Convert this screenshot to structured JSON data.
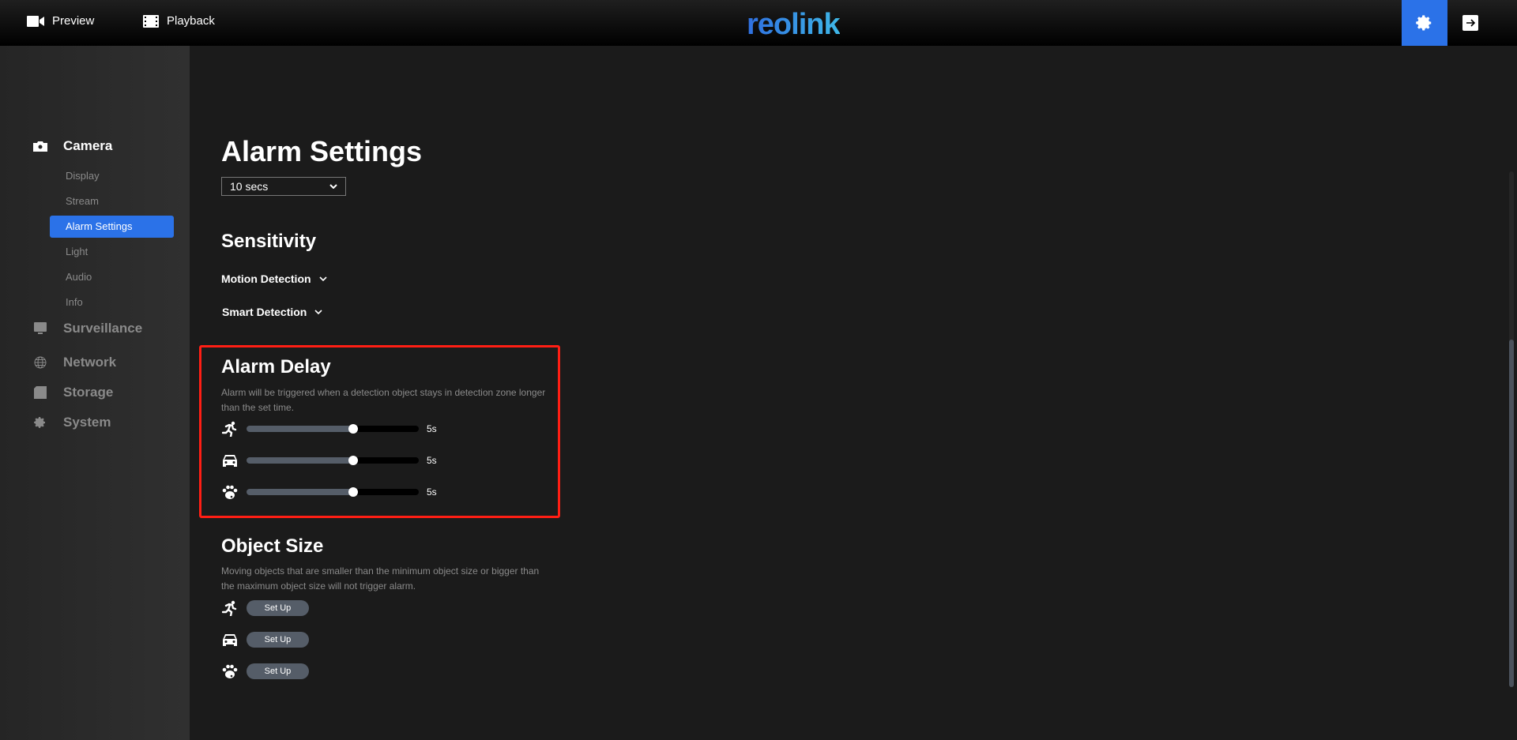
{
  "header": {
    "nav": [
      {
        "label": "Preview",
        "icon": "video-camera-icon"
      },
      {
        "label": "Playback",
        "icon": "film-icon"
      }
    ],
    "logo": "reolink",
    "accent": "#2b72e8"
  },
  "sidebar": {
    "groups": [
      {
        "label": "Camera",
        "icon": "camera-icon",
        "items": [
          "Display",
          "Stream",
          "Alarm Settings",
          "Light",
          "Audio",
          "Info"
        ],
        "active_item": "Alarm Settings"
      },
      {
        "label": "Surveillance",
        "icon": "monitor-icon"
      },
      {
        "label": "Network",
        "icon": "globe-icon"
      },
      {
        "label": "Storage",
        "icon": "storage-icon"
      },
      {
        "label": "System",
        "icon": "gear-icon"
      }
    ]
  },
  "main": {
    "title": "Alarm Settings",
    "duration_select": "10 secs",
    "sensitivity": {
      "title": "Sensitivity",
      "items": [
        "Motion Detection",
        "Smart Detection"
      ]
    },
    "alarm_delay": {
      "title": "Alarm Delay",
      "description": "Alarm will be triggered when a detection object stays in detection zone longer than the set time.",
      "sliders": [
        {
          "icon": "person-running-icon",
          "value": "5s",
          "fill_pct": 62
        },
        {
          "icon": "car-icon",
          "value": "5s",
          "fill_pct": 62
        },
        {
          "icon": "paw-icon",
          "value": "5s",
          "fill_pct": 62
        }
      ]
    },
    "object_size": {
      "title": "Object Size",
      "description": "Moving objects that are smaller than the minimum object size or bigger than the maximum object size will not trigger alarm.",
      "buttons": [
        {
          "icon": "person-running-icon",
          "label": "Set Up"
        },
        {
          "icon": "car-icon",
          "label": "Set Up"
        },
        {
          "icon": "paw-icon",
          "label": "Set Up"
        }
      ]
    }
  }
}
